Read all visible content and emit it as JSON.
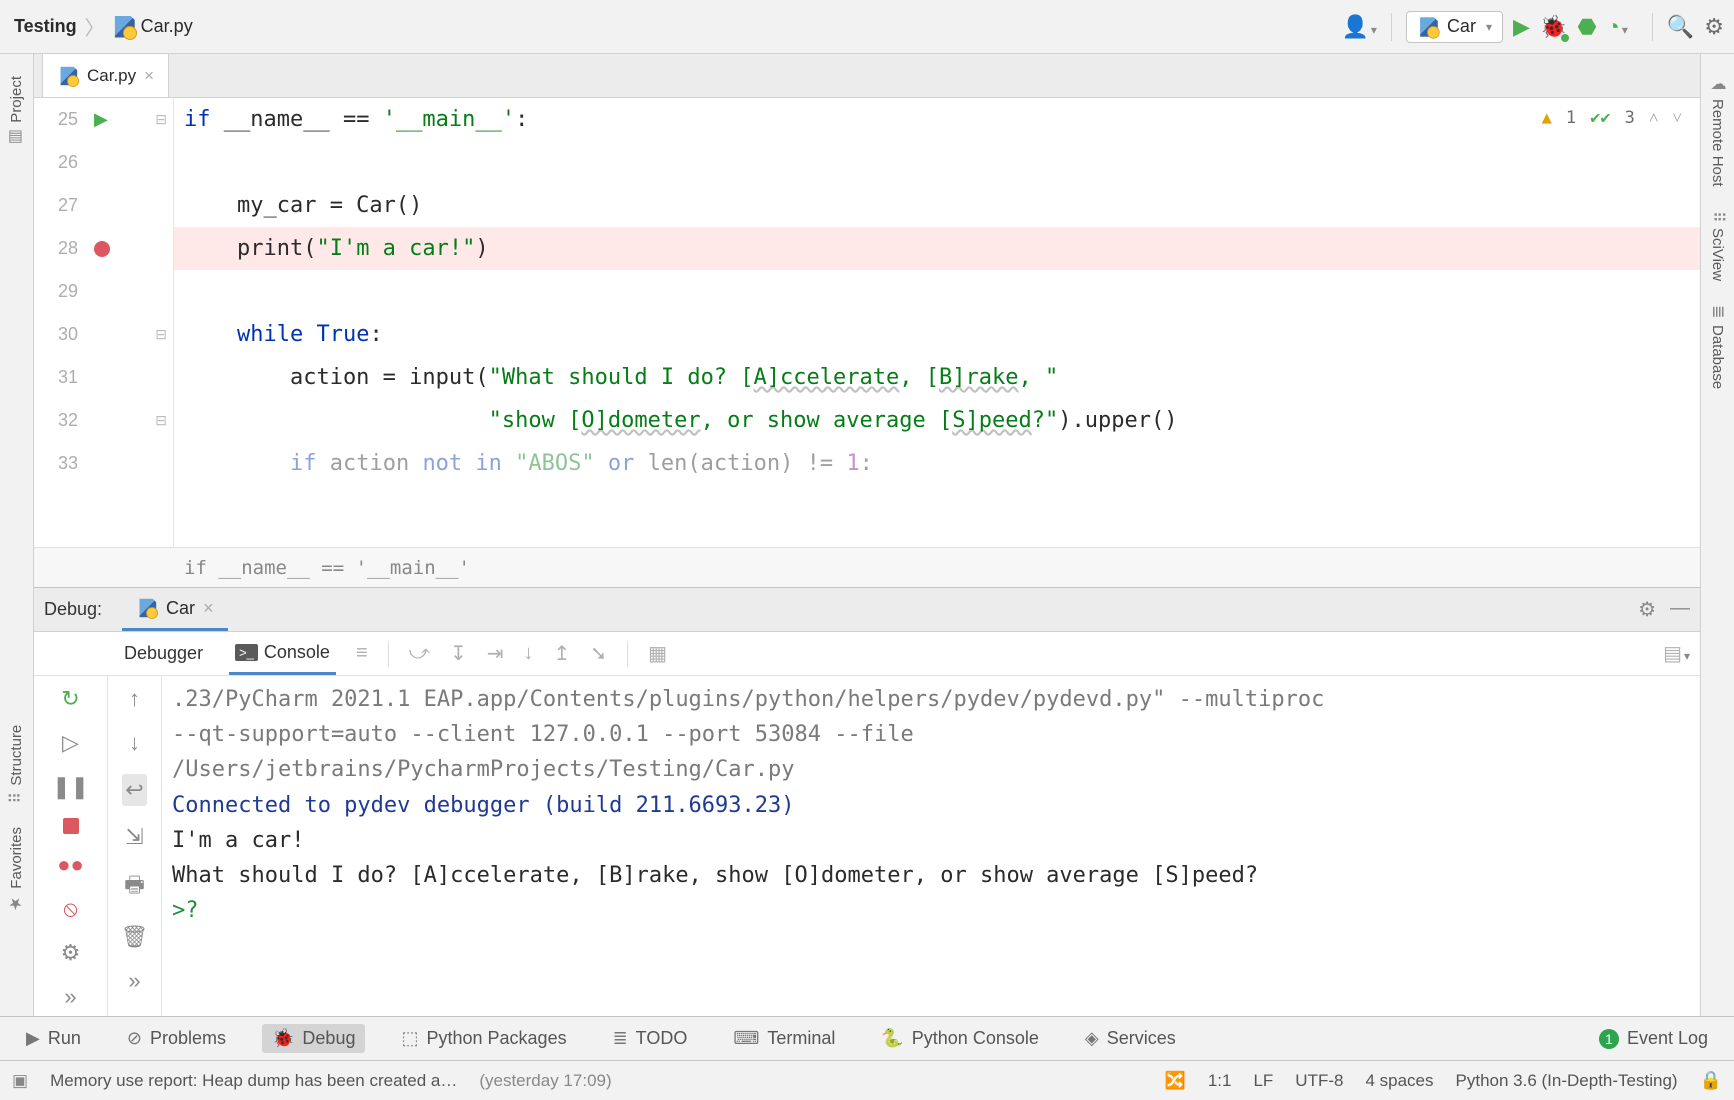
{
  "breadcrumb": {
    "project": "Testing",
    "file": "Car.py"
  },
  "run_config": "Car",
  "editor_tab": {
    "label": "Car.py"
  },
  "hints": {
    "warn": "1",
    "ok": "3"
  },
  "gutter": [
    "25",
    "26",
    "27",
    "28",
    "29",
    "30",
    "31",
    "32",
    "33"
  ],
  "code": {
    "l25a": "if",
    "l25b": " __name__ ",
    "l25c": "==",
    "l25d": " '__main__'",
    "l25e": ":",
    "l27a": "    my_car = Car()",
    "l28a": "    print(",
    "l28b": "\"I'm a car!\"",
    "l28c": ")",
    "l30a": "    ",
    "l30b": "while",
    "l30c": " True",
    "l30d": ":",
    "l31a": "        action = input(",
    "l31b": "\"What should I do? [",
    "l31c": "A]ccelerate",
    "l31d": ", [",
    "l31e": "B]rake",
    "l31f": ", \"",
    "l32a": "                       ",
    "l32b": "\"show [",
    "l32c": "O]dometer",
    "l32d": ", or show average [",
    "l32e": "S]peed",
    "l32f": "?\"",
    "l32g": ").upper()",
    "l33a": "        ",
    "l33b": "if",
    "l33c": " action ",
    "l33d": "not in",
    "l33e": " ",
    "l33f": "\"ABOS\"",
    "l33g": " ",
    "l33h": "or",
    "l33i": " len(action) != ",
    "l33j": "1",
    "l33k": ":"
  },
  "code_breadcrumb": "if __name__ == '__main__'",
  "debug": {
    "title": "Debug:",
    "tab": "Car",
    "subtabs": {
      "debugger": "Debugger",
      "console": "Console"
    }
  },
  "console": {
    "l1": ".23/PyCharm 2021.1 EAP.app/Contents/plugins/python/helpers/pydev/pydevd.py\" --multiproc",
    "l2": "--qt-support=auto --client 127.0.0.1 --port 53084 --file",
    "l3": "/Users/jetbrains/PycharmProjects/Testing/Car.py",
    "l4": "Connected to pydev debugger (build 211.6693.23)",
    "l5": "I'm a car!",
    "l6": "What should I do? [A]ccelerate, [B]rake, show [O]dometer, or show average [S]peed?",
    "prompt": ">?"
  },
  "tools": {
    "run": "Run",
    "problems": "Problems",
    "debug": "Debug",
    "packages": "Python Packages",
    "todo": "TODO",
    "terminal": "Terminal",
    "pyconsole": "Python Console",
    "services": "Services",
    "eventlog": "Event Log",
    "event_badge": "1"
  },
  "status": {
    "msg": "Memory use report: Heap dump has been created a…",
    "ts": "(yesterday 17:09)",
    "caret": "1:1",
    "le": "LF",
    "enc": "UTF-8",
    "indent": "4 spaces",
    "interpreter": "Python 3.6 (In-Depth-Testing)"
  },
  "right_rail": {
    "remote": "Remote Host",
    "sciview": "SciView",
    "database": "Database"
  },
  "left_rail": {
    "project": "Project",
    "structure": "Structure",
    "favorites": "Favorites"
  }
}
